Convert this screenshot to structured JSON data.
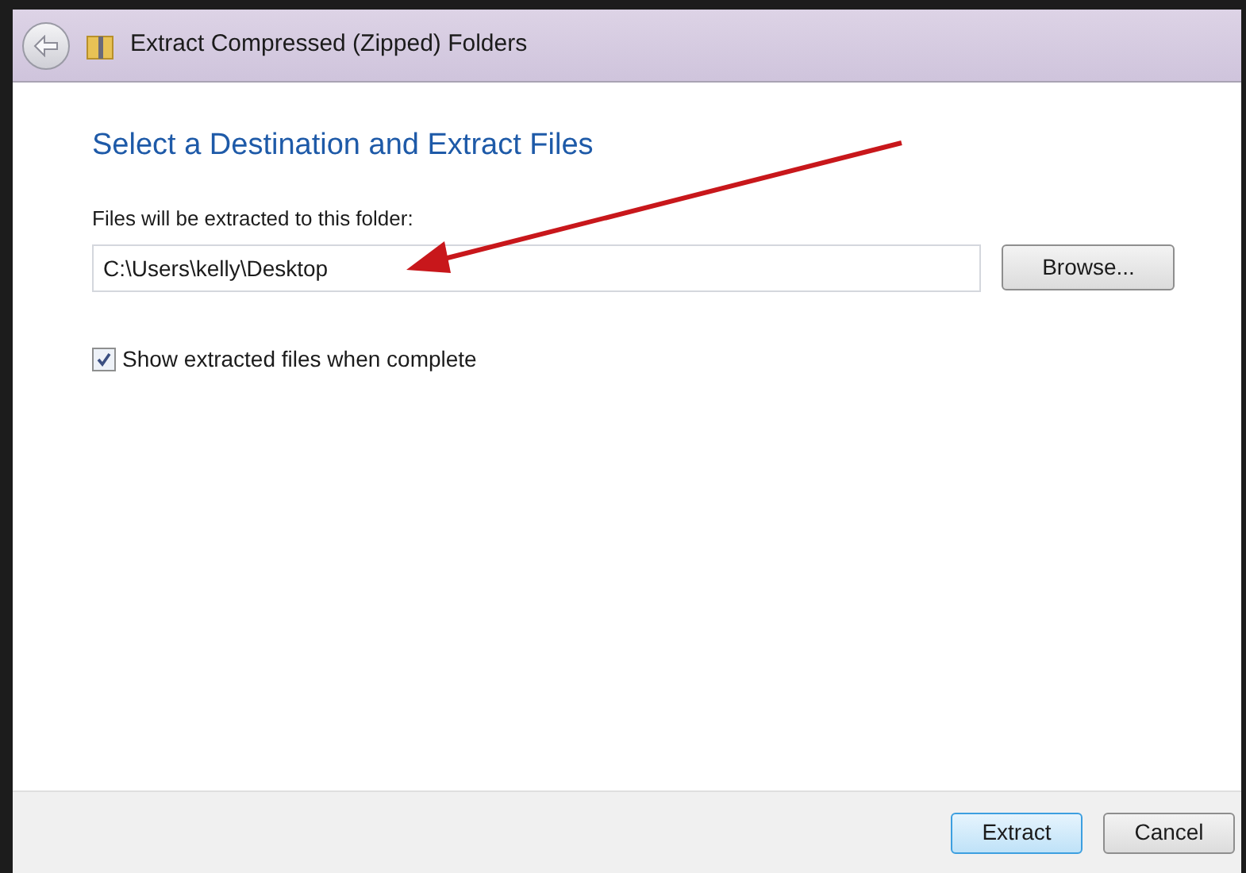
{
  "window": {
    "title": "Extract Compressed (Zipped) Folders"
  },
  "heading": "Select a Destination and Extract Files",
  "destination": {
    "label": "Files will be extracted to this folder:",
    "value": "C:\\Users\\kelly\\Desktop",
    "browse": "Browse..."
  },
  "show_files": {
    "label": "Show extracted files when complete",
    "checked": true
  },
  "buttons": [
    {
      "label": "Extract",
      "default": true
    },
    {
      "label": "Cancel",
      "default": false
    }
  ]
}
